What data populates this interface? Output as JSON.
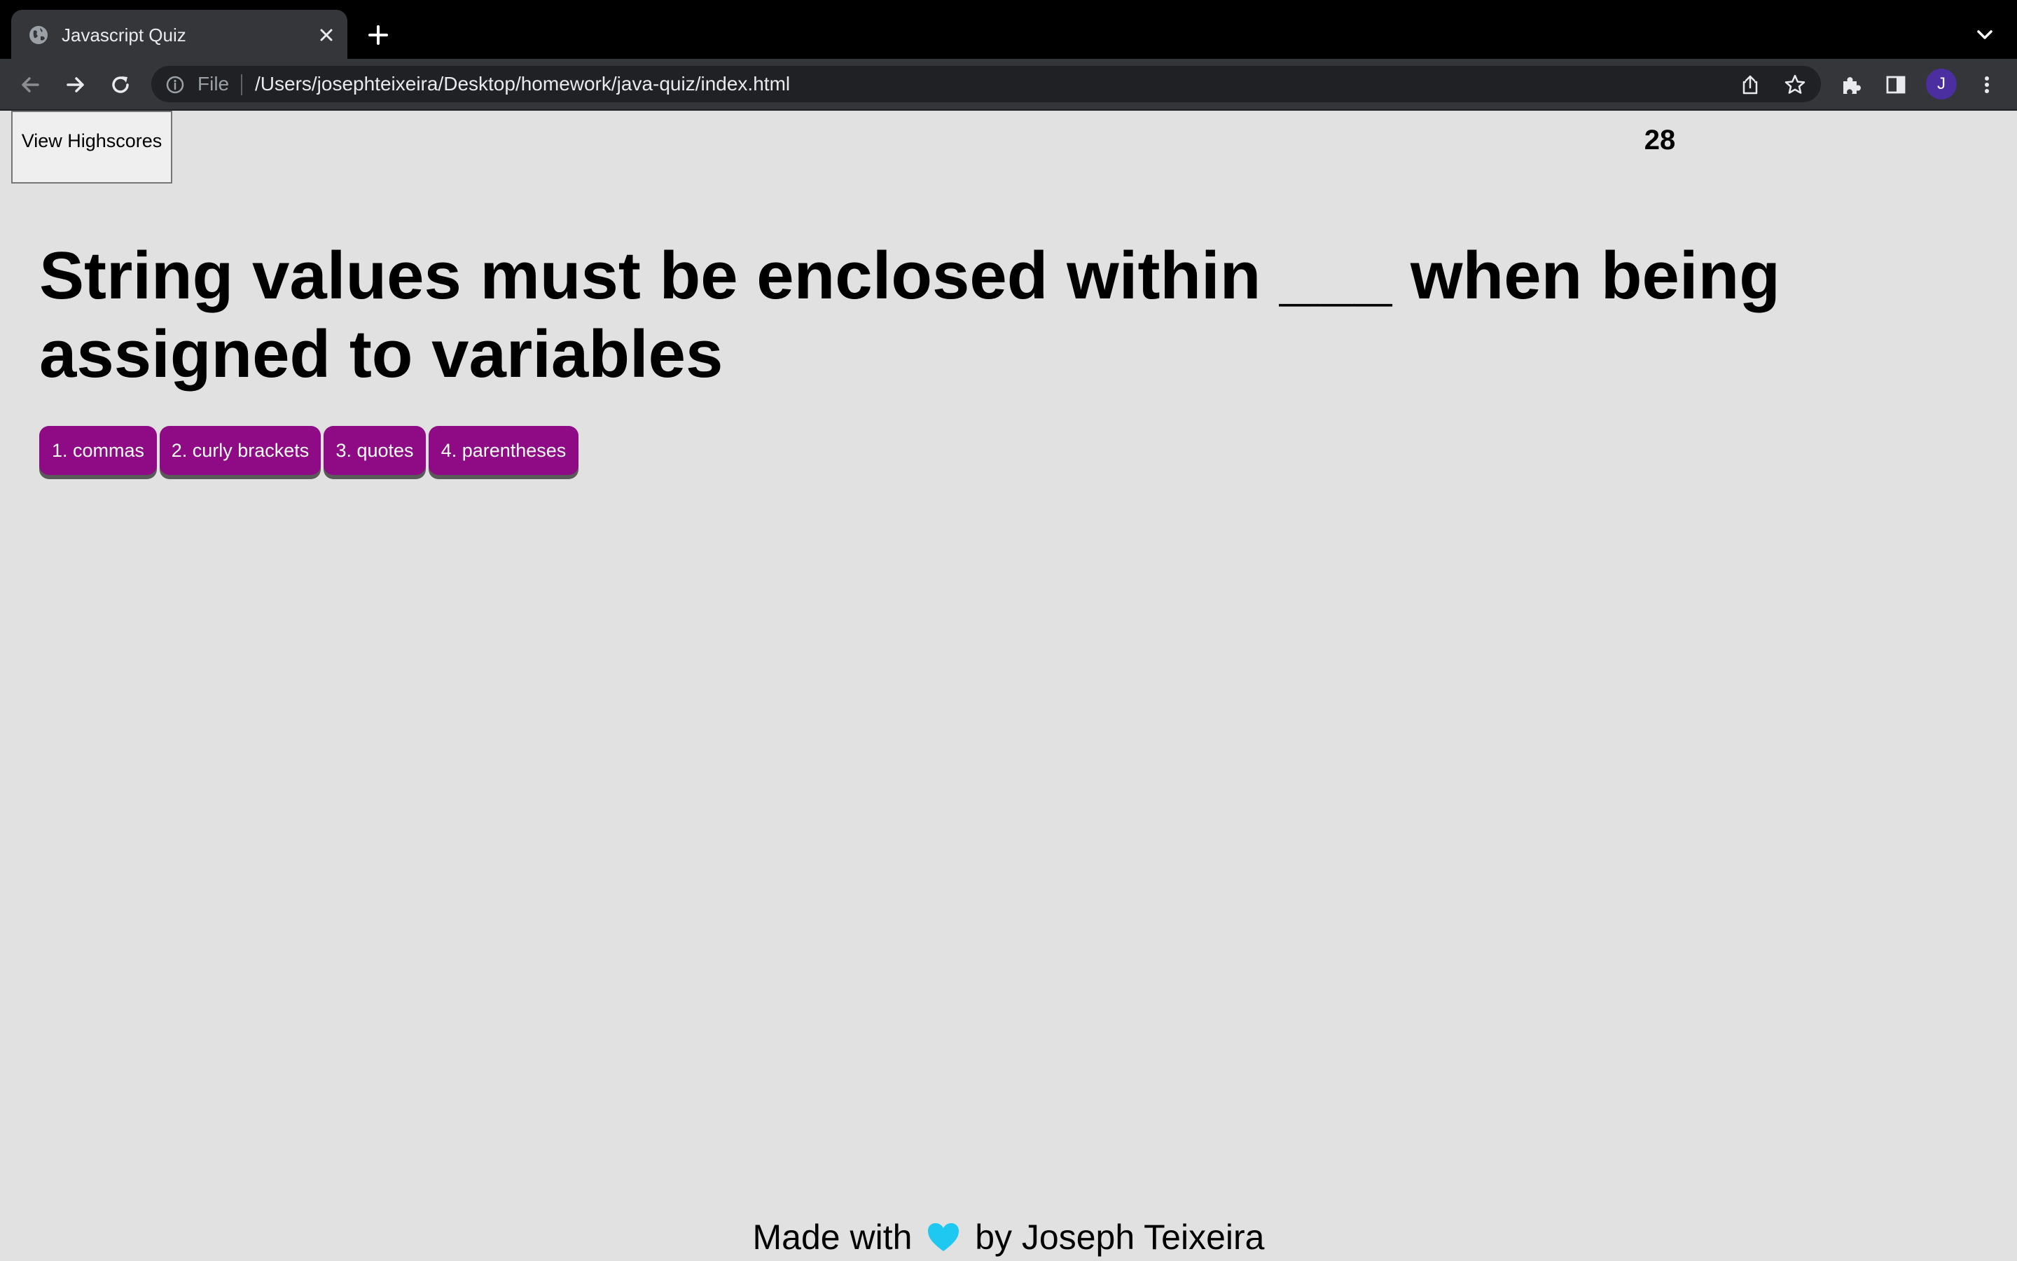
{
  "browser": {
    "tab": {
      "title": "Javascript Quiz",
      "favicon": "globe-icon"
    },
    "address_bar": {
      "scheme_label": "File",
      "url": "/Users/josephteixeira/Desktop/homework/java-quiz/index.html"
    },
    "profile_initial": "J"
  },
  "header": {
    "highscores_label": "View Highscores",
    "timer": "28"
  },
  "quiz": {
    "question": "String values must be enclosed within ___ when being assigned to variables",
    "choices": [
      {
        "label": "1. commas"
      },
      {
        "label": "2. curly brackets"
      },
      {
        "label": "3. quotes"
      },
      {
        "label": "4. parentheses"
      }
    ]
  },
  "footer": {
    "prefix": "Made with",
    "icon": "heart-icon",
    "suffix": "by Joseph Teixeira"
  },
  "colors": {
    "page_background": "#e1e1e1",
    "choice_button": "#8e0b85",
    "heart": "#1fc8f0",
    "avatar": "#4b2fa0"
  }
}
